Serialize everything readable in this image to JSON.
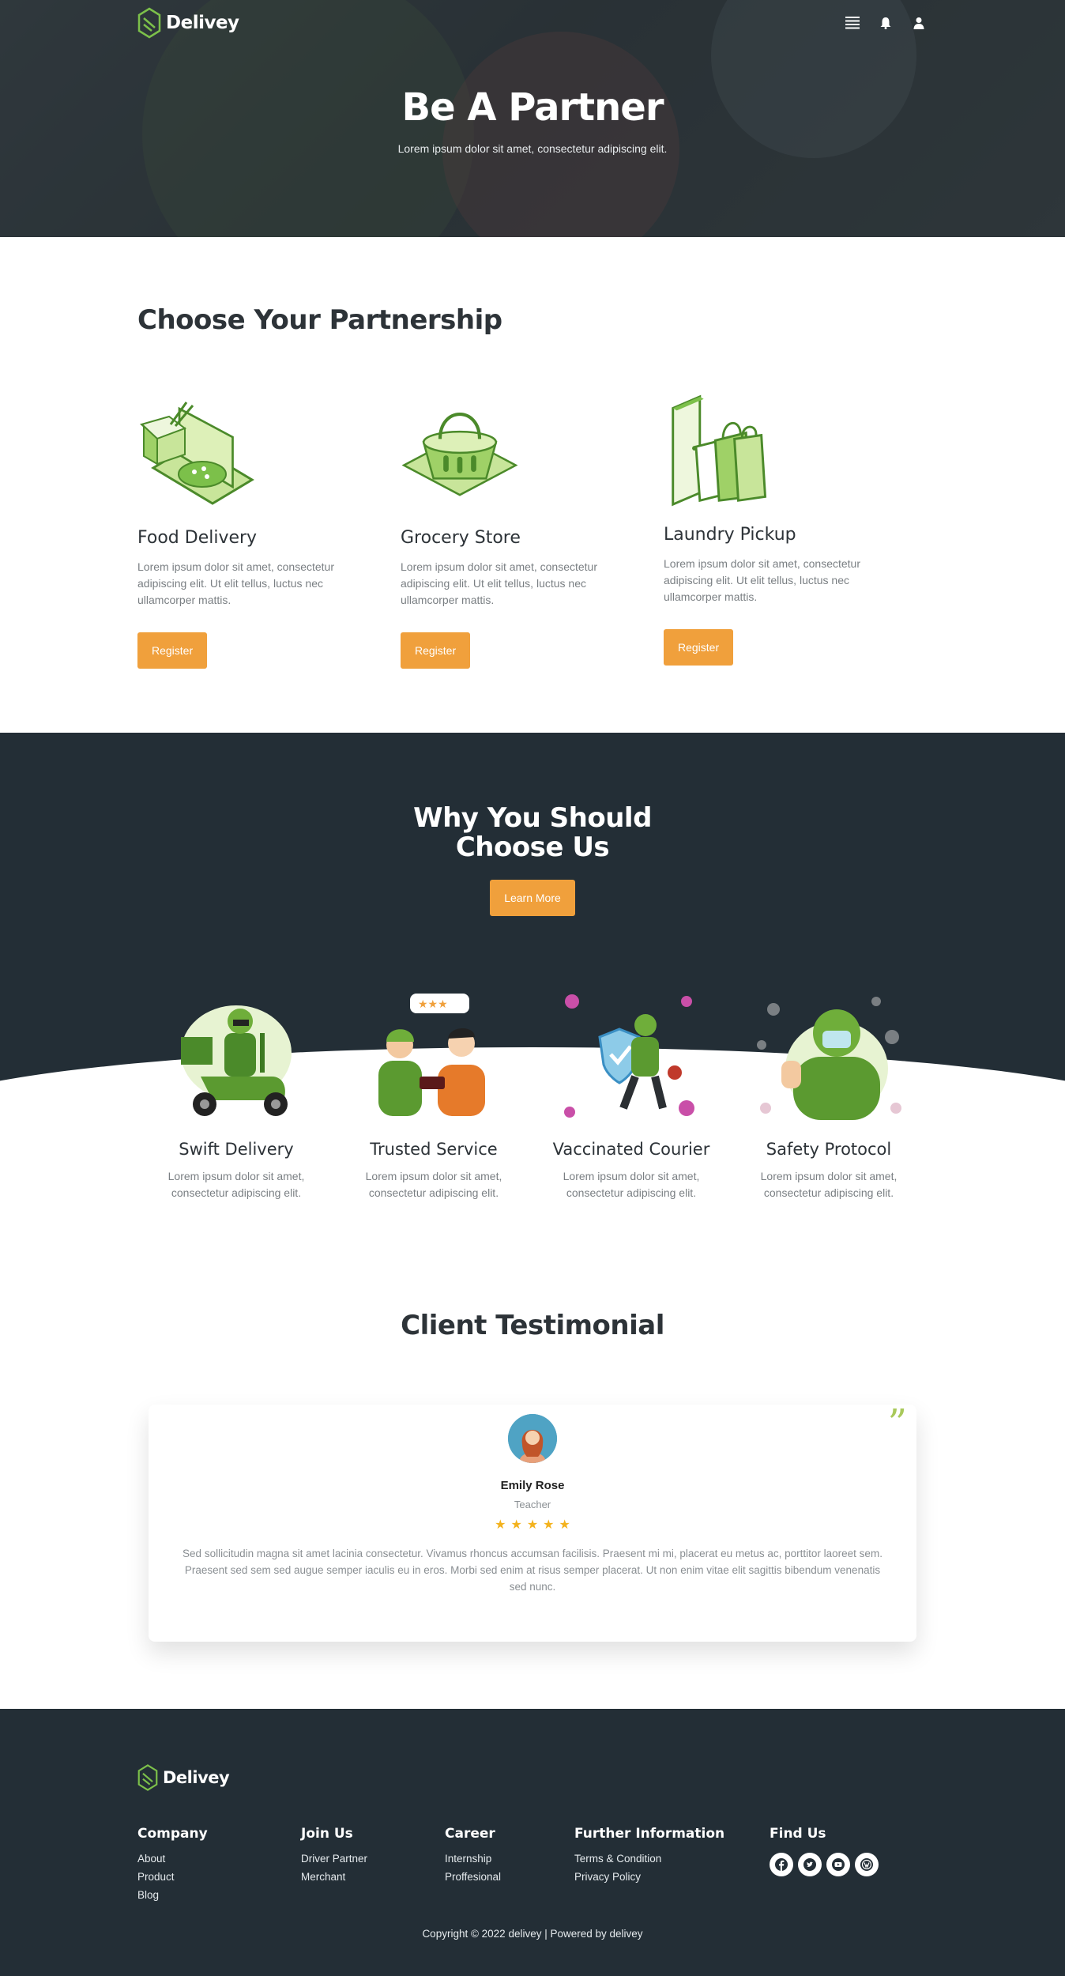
{
  "header": {
    "brand": "Delivey",
    "title": "Be A Partner",
    "subtitle": "Lorem ipsum dolor sit amet, consectetur adipiscing elit."
  },
  "partnership": {
    "heading": "Choose Your Partnership",
    "cards": [
      {
        "title": "Food Delivery",
        "text": "Lorem ipsum dolor sit amet, consectetur adipiscing elit. Ut elit tellus, luctus nec ullamcorper mattis.",
        "button": "Register"
      },
      {
        "title": "Grocery Store",
        "text": "Lorem ipsum dolor sit amet, consectetur adipiscing elit. Ut elit tellus, luctus nec ullamcorper mattis.",
        "button": "Register"
      },
      {
        "title": "Laundry Pickup",
        "text": "Lorem ipsum dolor sit amet, consectetur adipiscing elit. Ut elit tellus, luctus nec ullamcorper mattis.",
        "button": "Register"
      }
    ]
  },
  "why": {
    "title_line1": "Why You Should",
    "title_line2": "Choose Us",
    "button": "Learn More",
    "features": [
      {
        "title": "Swift Delivery",
        "text": "Lorem ipsum dolor sit amet, consectetur adipiscing elit."
      },
      {
        "title": "Trusted Service",
        "text": "Lorem ipsum dolor sit amet, consectetur adipiscing elit."
      },
      {
        "title": "Vaccinated Courier",
        "text": "Lorem ipsum dolor sit amet, consectetur adipiscing elit."
      },
      {
        "title": "Safety Protocol",
        "text": "Lorem ipsum dolor sit amet, consectetur adipiscing elit."
      }
    ]
  },
  "testimonial": {
    "heading": "Client Testimonial",
    "name": "Emily Rose",
    "role": "Teacher",
    "rating": 5,
    "quote": "Sed sollicitudin magna sit amet lacinia consectetur. Vivamus rhoncus accumsan facilisis. Praesent mi mi, placerat eu metus ac, porttitor laoreet sem. Praesent sed sem sed augue semper iaculis eu in eros. Morbi sed enim at risus semper placerat. Ut non enim vitae elit sagittis bibendum venenatis sed nunc."
  },
  "footer": {
    "brand": "Delivey",
    "columns": {
      "company": {
        "title": "Company",
        "links": [
          "About",
          "Product",
          "Blog"
        ]
      },
      "join": {
        "title": "Join Us",
        "links": [
          "Driver Partner",
          "Merchant"
        ]
      },
      "career": {
        "title": "Career",
        "links": [
          "Internship",
          "Proffesional"
        ]
      },
      "info": {
        "title": "Further Information",
        "links": [
          "Terms & Condition",
          "Privacy Policy"
        ]
      },
      "find": {
        "title": "Find Us"
      }
    },
    "socials": [
      "facebook-icon",
      "twitter-icon",
      "youtube-icon",
      "wordpress-icon"
    ],
    "copyright": "Copyright © 2022 delivey | Powered by delivey"
  },
  "colors": {
    "accent": "#f0a03c",
    "dark": "#232e36",
    "brand_green": "#6fae3a",
    "light_green": "#c8e59a"
  }
}
